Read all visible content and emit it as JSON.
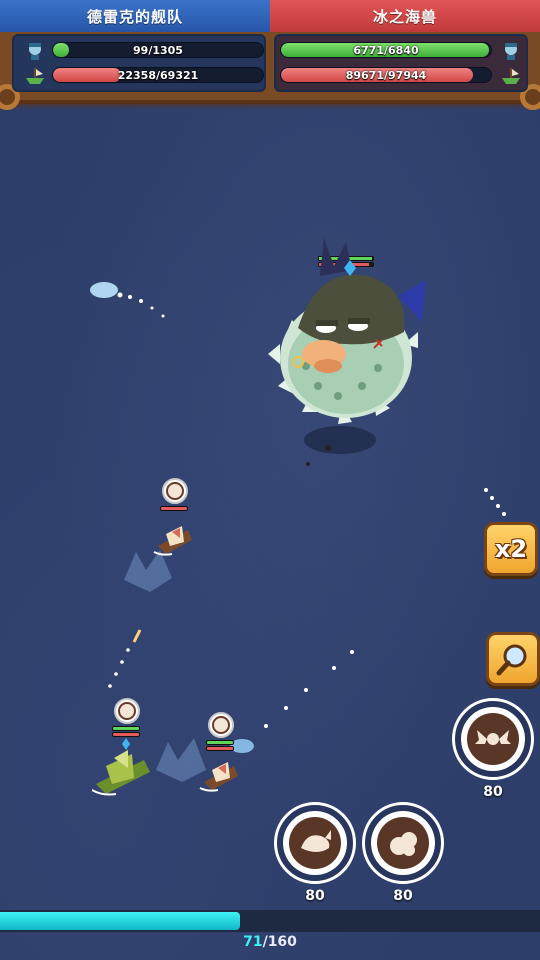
{
  "hud": {
    "player_team": {
      "name": "德雷克的舰队",
      "crew": {
        "text": "99/1305",
        "current": 99,
        "max": 1305
      },
      "ship_hp": {
        "text": "22358/69321",
        "current": 22358,
        "max": 69321
      }
    },
    "enemy_team": {
      "name": "冰之海兽",
      "crew": {
        "text": "6771/6840",
        "current": 6771,
        "max": 6840
      },
      "ship_hp": {
        "text": "89671/97944",
        "current": 89671,
        "max": 97944
      }
    }
  },
  "boss": {
    "icon": "pufferfish-sea-beast",
    "hp_fraction": 0.92,
    "crew_fraction": 0.99
  },
  "controls": {
    "speed_label": "x2",
    "magnify_icon": "magnifier-icon",
    "skills": [
      {
        "icon": "wing-crest-icon",
        "cost": "80"
      },
      {
        "icon": "whale-icon",
        "cost": "80"
      },
      {
        "icon": "smoke-bomb-icon",
        "cost": "80"
      }
    ]
  },
  "energy": {
    "current": "71",
    "separator": "/",
    "max": "160",
    "fraction": 0.444
  },
  "colors": {
    "player_blue": "#2f64b8",
    "enemy_red": "#d04545",
    "crew_green": "#4fc447",
    "hp_red": "#e06262",
    "energy_cyan": "#2ad6e2",
    "sea": "#2e3e6a"
  }
}
